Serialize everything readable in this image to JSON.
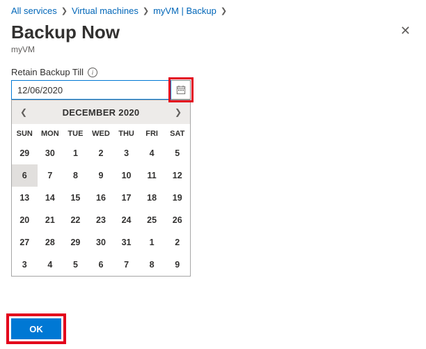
{
  "breadcrumb": {
    "items": [
      {
        "label": "All services"
      },
      {
        "label": "Virtual machines"
      },
      {
        "label": "myVM | Backup"
      }
    ]
  },
  "header": {
    "title": "Backup Now",
    "subtitle": "myVM"
  },
  "field": {
    "label": "Retain Backup Till",
    "value": "12/06/2020"
  },
  "calendar": {
    "month_label": "DECEMBER 2020",
    "dow": [
      "SUN",
      "MON",
      "TUE",
      "WED",
      "THU",
      "FRI",
      "SAT"
    ],
    "weeks": [
      [
        {
          "d": "29",
          "other": true
        },
        {
          "d": "30",
          "other": true
        },
        {
          "d": "1"
        },
        {
          "d": "2"
        },
        {
          "d": "3"
        },
        {
          "d": "4"
        },
        {
          "d": "5"
        }
      ],
      [
        {
          "d": "6",
          "selected": true
        },
        {
          "d": "7"
        },
        {
          "d": "8"
        },
        {
          "d": "9"
        },
        {
          "d": "10"
        },
        {
          "d": "11"
        },
        {
          "d": "12"
        }
      ],
      [
        {
          "d": "13"
        },
        {
          "d": "14"
        },
        {
          "d": "15"
        },
        {
          "d": "16"
        },
        {
          "d": "17"
        },
        {
          "d": "18"
        },
        {
          "d": "19"
        }
      ],
      [
        {
          "d": "20"
        },
        {
          "d": "21"
        },
        {
          "d": "22"
        },
        {
          "d": "23"
        },
        {
          "d": "24"
        },
        {
          "d": "25"
        },
        {
          "d": "26"
        }
      ],
      [
        {
          "d": "27"
        },
        {
          "d": "28"
        },
        {
          "d": "29"
        },
        {
          "d": "30"
        },
        {
          "d": "31"
        },
        {
          "d": "1",
          "other": true
        },
        {
          "d": "2",
          "other": true
        }
      ],
      [
        {
          "d": "3",
          "other": true
        },
        {
          "d": "4",
          "other": true
        },
        {
          "d": "5",
          "other": true
        },
        {
          "d": "6",
          "other": true
        },
        {
          "d": "7",
          "other": true
        },
        {
          "d": "8",
          "other": true
        },
        {
          "d": "9",
          "other": true
        }
      ]
    ]
  },
  "footer": {
    "ok_label": "OK"
  }
}
